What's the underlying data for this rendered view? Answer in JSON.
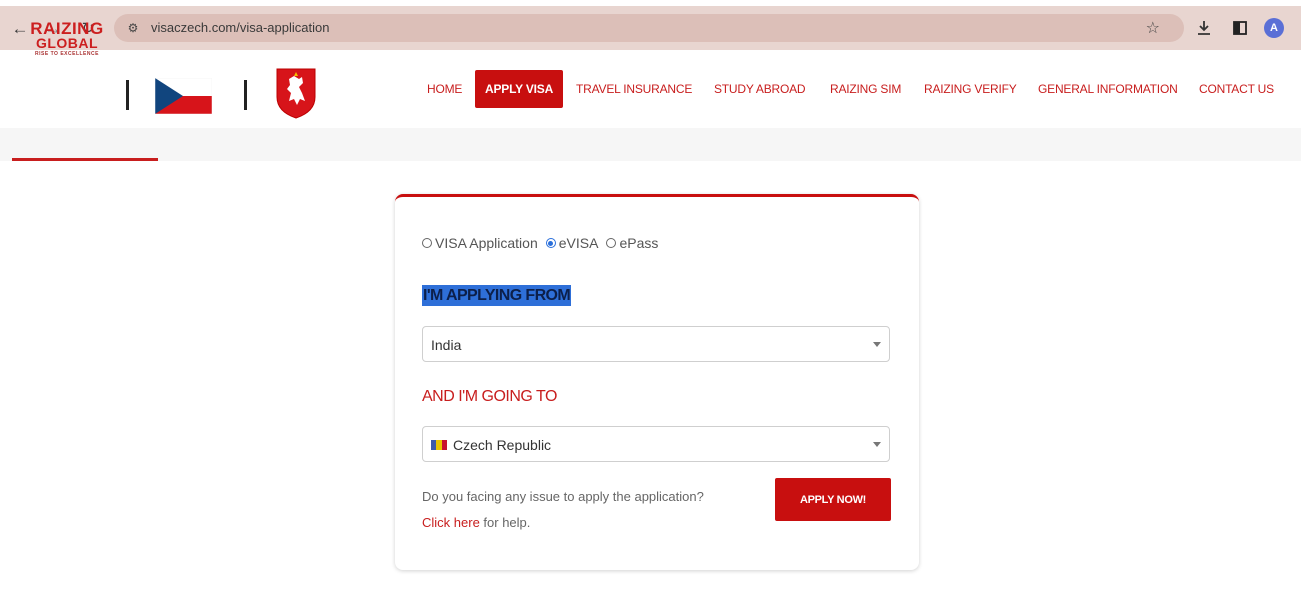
{
  "browser": {
    "url": "visaczech.com/visa-application",
    "avatar_letter": "A",
    "bar_color": "#e8d5d0"
  },
  "logo": {
    "line1": "RAIZING",
    "line2": "GLOBAL",
    "line3": "RISE TO EXCELLENCE"
  },
  "nav": {
    "items": [
      {
        "label": "HOME"
      },
      {
        "label": "APPLY VISA"
      },
      {
        "label": "TRAVEL INSURANCE"
      },
      {
        "label": "STUDY ABROAD"
      },
      {
        "label": "RAIZING SIM"
      },
      {
        "label": "RAIZING VERIFY"
      },
      {
        "label": "GENERAL INFORMATION"
      },
      {
        "label": "CONTACT US"
      }
    ],
    "active": "APPLY VISA",
    "accent": "#c80f0f"
  },
  "form": {
    "options": [
      "VISA Application",
      "eVISA",
      "ePass"
    ],
    "selected_option": "eVISA",
    "from_heading": "I'M APPLYING FROM",
    "from_value": "India",
    "to_heading": "AND I'M GOING TO",
    "to_value": "Czech Republic",
    "help_text": "Do you facing any issue to apply the application?",
    "help_link": "Click here",
    "help_suffix": " for help.",
    "submit_label": "APPLY NOW!"
  }
}
